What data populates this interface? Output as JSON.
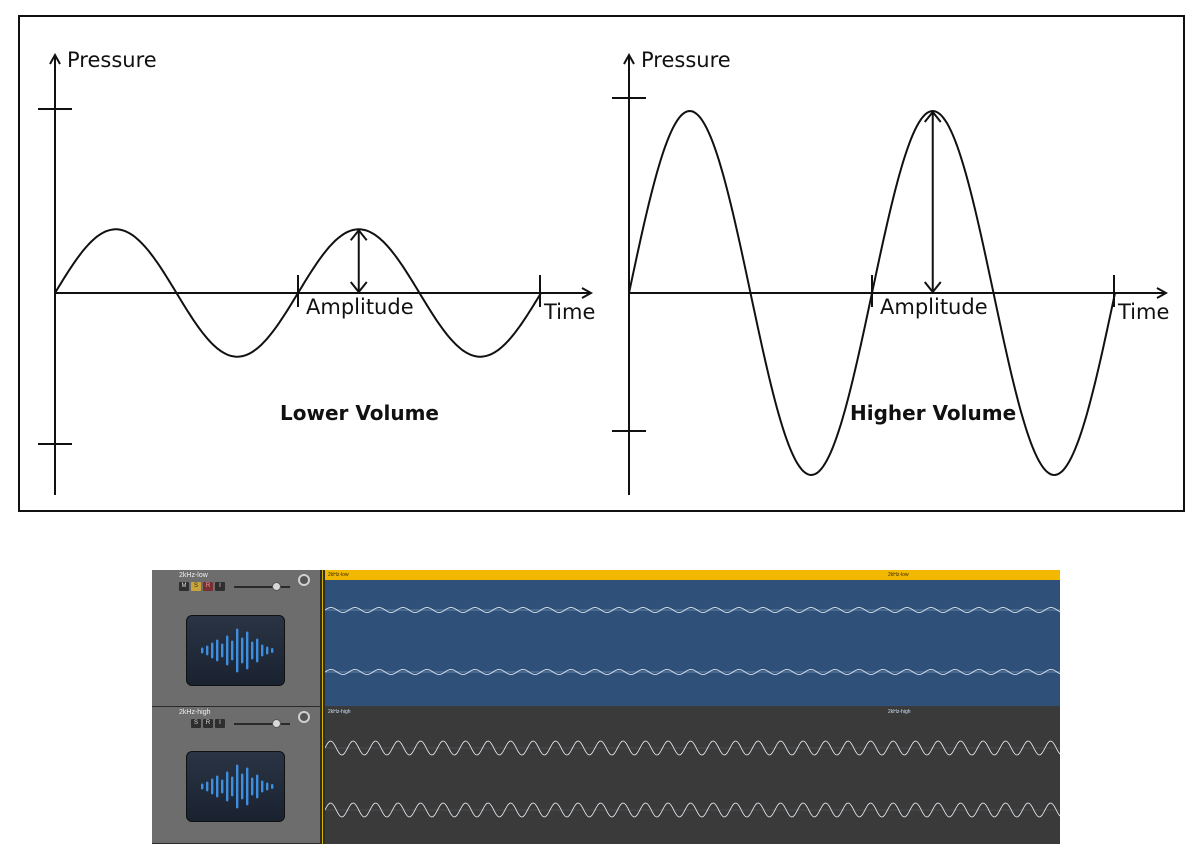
{
  "diagram": {
    "left_panel": {
      "y_label": "Pressure",
      "x_label": "Time",
      "amplitude_label": "Amplitude",
      "caption": "Lower Volume",
      "amplitude_fraction": 0.35
    },
    "right_panel": {
      "y_label": "Pressure",
      "x_label": "Time",
      "amplitude_label": "Amplitude",
      "caption": "Higher Volume",
      "amplitude_fraction": 1.0
    }
  },
  "daw": {
    "tracks": [
      {
        "name": "2kHz-low",
        "buttons": [
          "M",
          "S",
          "R",
          "I"
        ],
        "region_labels": [
          "2kHz-low",
          "2kHz-low"
        ],
        "selected": true,
        "volume_fraction": 0.75
      },
      {
        "name": "2kHz-high",
        "buttons": [
          "S",
          "R",
          "I"
        ],
        "region_labels": [
          "2kHz-high",
          "2kHz-high"
        ],
        "selected": false,
        "volume_fraction": 0.75
      }
    ],
    "colors": {
      "selected_region": "#2e5079",
      "region_header": "#f2b800",
      "unselected_region": "#3a3a3a",
      "waveform_icon": "#3f8fe0"
    }
  }
}
